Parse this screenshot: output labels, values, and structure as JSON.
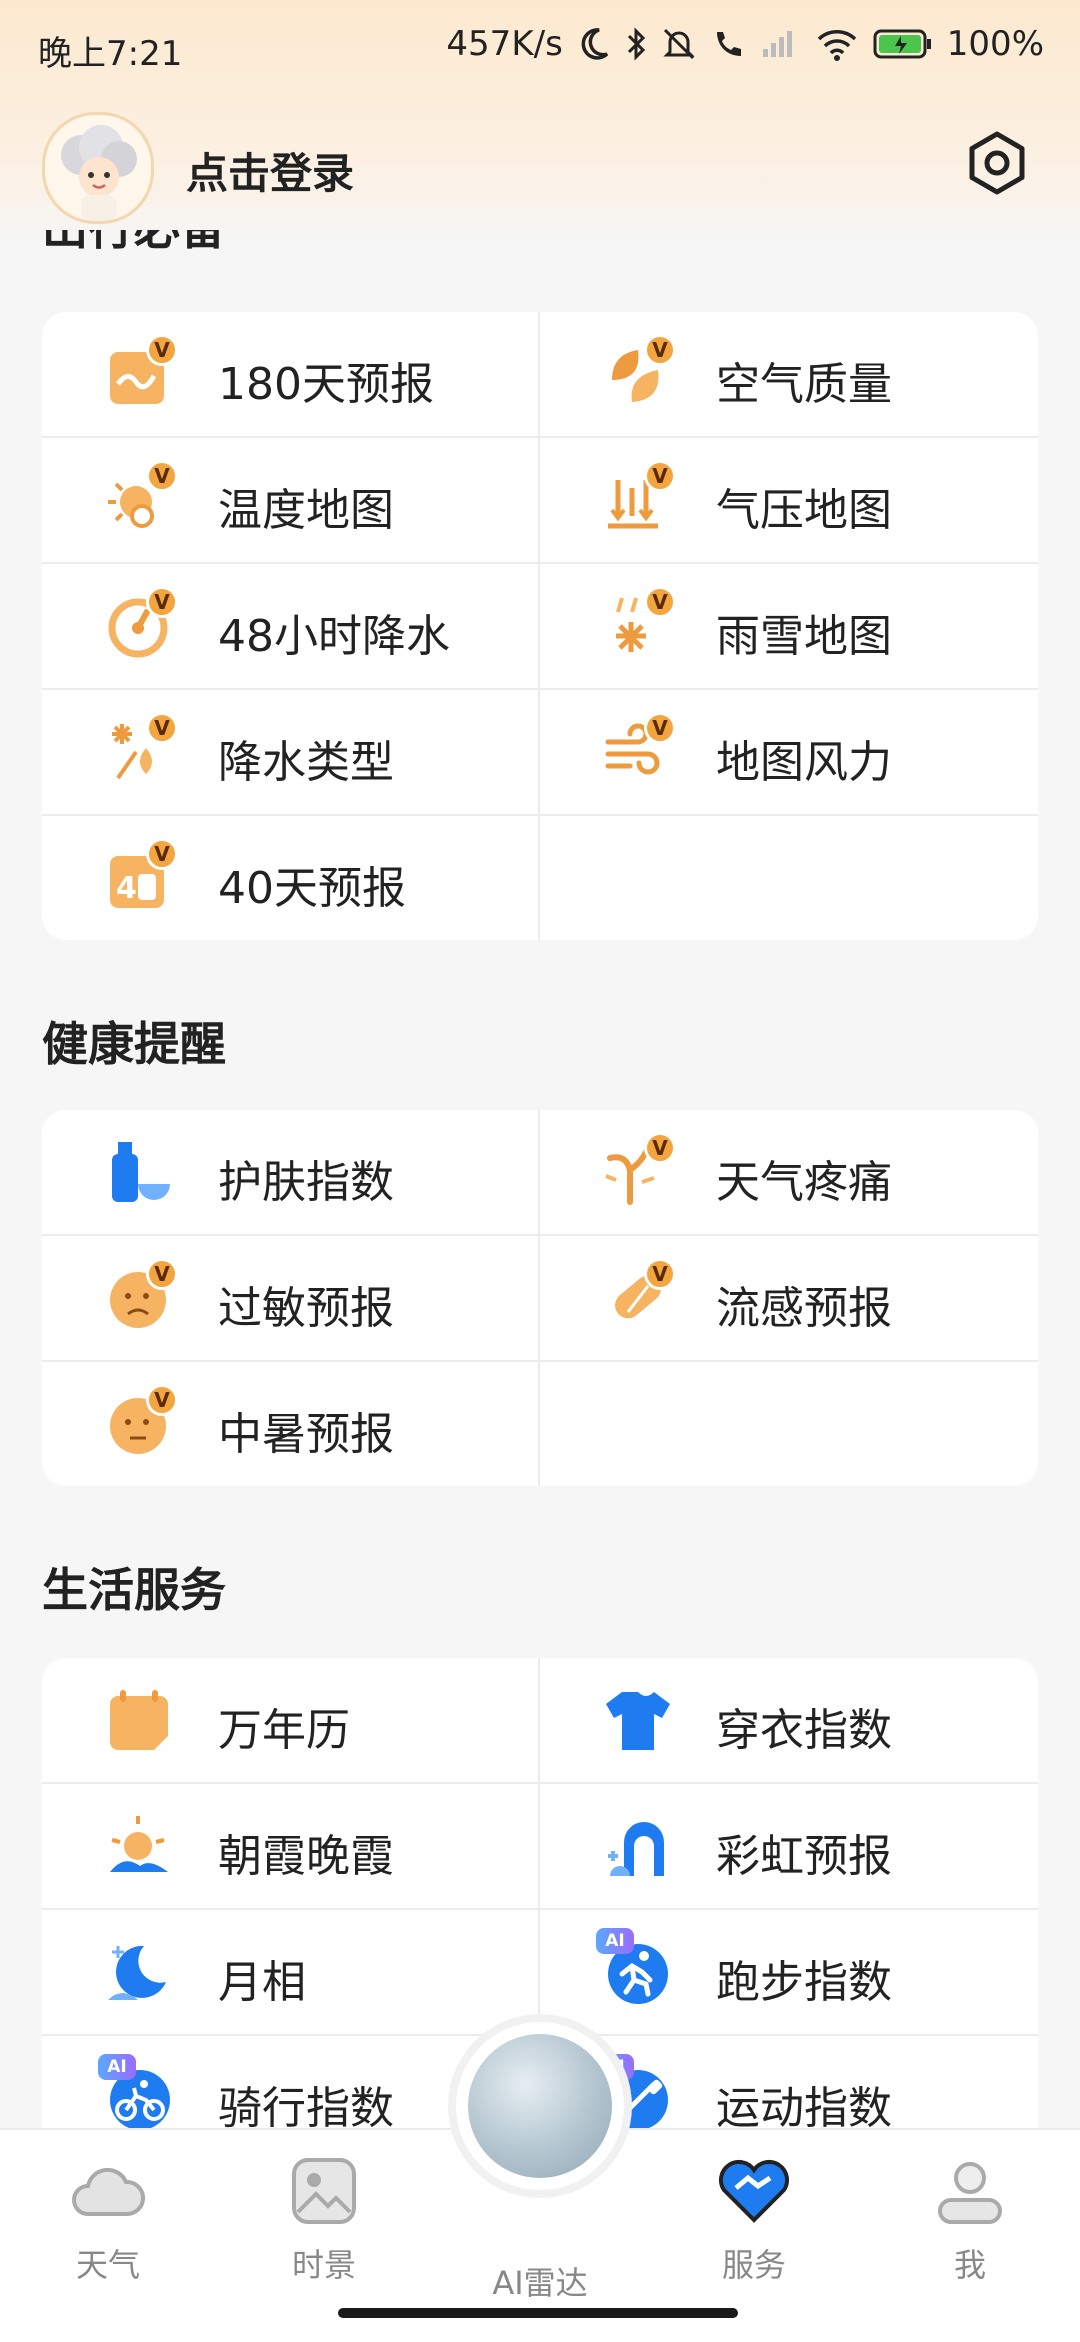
{
  "status": {
    "time": "晚上7:21",
    "speed": "457K/s",
    "battery": "100%"
  },
  "header": {
    "login": "点击登录"
  },
  "sections": [
    {
      "title": "出行必备",
      "items": [
        {
          "label": "180天预报",
          "icon": "calendar-180-icon",
          "badge": "V"
        },
        {
          "label": "空气质量",
          "icon": "leaf-icon",
          "badge": "V"
        },
        {
          "label": "温度地图",
          "icon": "temperature-map-icon",
          "badge": "V"
        },
        {
          "label": "气压地图",
          "icon": "pressure-map-icon",
          "badge": "V"
        },
        {
          "label": "48小时降水",
          "icon": "rain-48h-icon",
          "badge": "V"
        },
        {
          "label": "雨雪地图",
          "icon": "rain-snow-map-icon",
          "badge": "V"
        },
        {
          "label": "降水类型",
          "icon": "precipitation-type-icon",
          "badge": "V"
        },
        {
          "label": "地图风力",
          "icon": "wind-map-icon",
          "badge": "V"
        },
        {
          "label": "40天预报",
          "icon": "calendar-40-icon",
          "badge": "V"
        }
      ]
    },
    {
      "title": "健康提醒",
      "items": [
        {
          "label": "护肤指数",
          "icon": "skincare-icon",
          "badge": ""
        },
        {
          "label": "天气疼痛",
          "icon": "joint-pain-icon",
          "badge": "V"
        },
        {
          "label": "过敏预报",
          "icon": "allergy-icon",
          "badge": "V"
        },
        {
          "label": "流感预报",
          "icon": "flu-pill-icon",
          "badge": "V"
        },
        {
          "label": "中暑预报",
          "icon": "heatstroke-icon",
          "badge": "V"
        }
      ]
    },
    {
      "title": "生活服务",
      "items": [
        {
          "label": "万年历",
          "icon": "calendar-icon",
          "badge": ""
        },
        {
          "label": "穿衣指数",
          "icon": "tshirt-icon",
          "badge": ""
        },
        {
          "label": "朝霞晚霞",
          "icon": "sunrise-icon",
          "badge": ""
        },
        {
          "label": "彩虹预报",
          "icon": "rainbow-icon",
          "badge": ""
        },
        {
          "label": "月相",
          "icon": "moon-icon",
          "badge": ""
        },
        {
          "label": "跑步指数",
          "icon": "running-icon",
          "badge": "AI"
        },
        {
          "label": "骑行指数",
          "icon": "cycling-icon",
          "badge": "AI"
        },
        {
          "label": "运动指数",
          "icon": "exercise-icon",
          "badge": "AI"
        }
      ]
    }
  ],
  "nav": [
    {
      "label": "天气",
      "icon": "cloud-icon",
      "active": false
    },
    {
      "label": "时景",
      "icon": "image-icon",
      "active": false
    },
    {
      "label": "AI雷达",
      "icon": "radar-globe-icon",
      "active": false
    },
    {
      "label": "服务",
      "icon": "heart-handshake-icon",
      "active": true
    },
    {
      "label": "我",
      "icon": "person-icon",
      "active": false
    }
  ],
  "colors": {
    "accent": "#f0a24a",
    "blue": "#1e7cf0",
    "topbg": "#fde9cf"
  }
}
